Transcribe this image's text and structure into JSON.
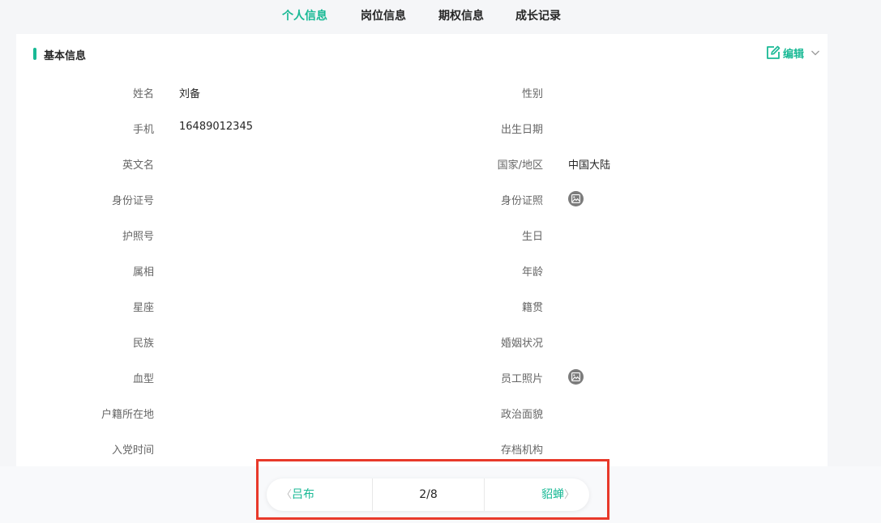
{
  "tabs": [
    "个人信息",
    "岗位信息",
    "期权信息",
    "成长记录"
  ],
  "active_tab": "个人信息",
  "section": {
    "title": "基本信息",
    "edit_label": "编辑"
  },
  "left_fields": [
    {
      "label": "姓名",
      "value": "刘备"
    },
    {
      "label": "手机",
      "value": "16489012345"
    },
    {
      "label": "英文名",
      "value": ""
    },
    {
      "label": "身份证号",
      "value": ""
    },
    {
      "label": "护照号",
      "value": ""
    },
    {
      "label": "属相",
      "value": ""
    },
    {
      "label": "星座",
      "value": ""
    },
    {
      "label": "民族",
      "value": ""
    },
    {
      "label": "血型",
      "value": ""
    },
    {
      "label": "户籍所在地",
      "value": ""
    },
    {
      "label": "入党时间",
      "value": ""
    }
  ],
  "right_fields": [
    {
      "label": "性别",
      "value": ""
    },
    {
      "label": "出生日期",
      "value": ""
    },
    {
      "label": "国家/地区",
      "value": "中国大陆"
    },
    {
      "label": "身份证照",
      "value": "",
      "icon": "image-icon"
    },
    {
      "label": "生日",
      "value": ""
    },
    {
      "label": "年龄",
      "value": ""
    },
    {
      "label": "籍贯",
      "value": ""
    },
    {
      "label": "婚姻状况",
      "value": ""
    },
    {
      "label": "员工照片",
      "value": "",
      "icon": "image-icon"
    },
    {
      "label": "政治面貌",
      "value": ""
    },
    {
      "label": "存档机构",
      "value": ""
    }
  ],
  "pager": {
    "prev_label": "吕布",
    "page": "2/8",
    "next_label": "貂蝉"
  },
  "colors": {
    "accent": "#19b995",
    "highlight_border": "#e8392a"
  }
}
